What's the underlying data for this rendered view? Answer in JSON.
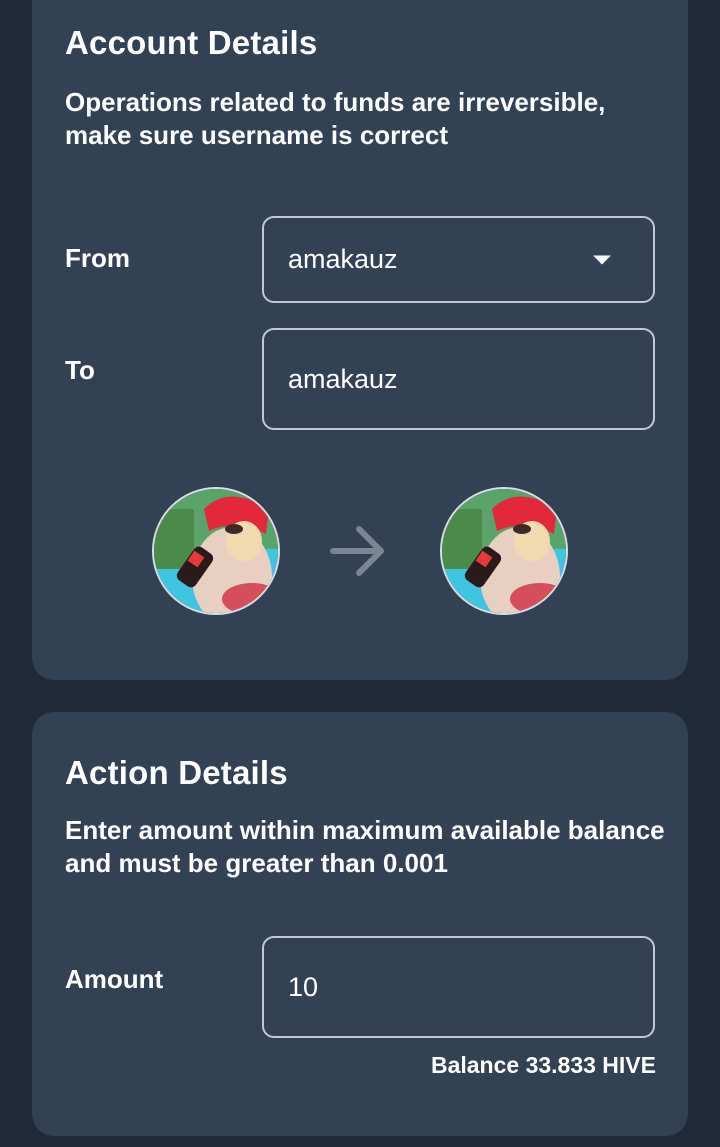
{
  "account": {
    "title": "Account Details",
    "description": "Operations related to funds are irreversible, make sure username is correct",
    "from_label": "From",
    "from_value": "amakauz",
    "to_label": "To",
    "to_value": "amakauz"
  },
  "action": {
    "title": "Action Details",
    "description": "Enter amount within maximum available balance  and must be greater than 0.001",
    "amount_label": "Amount",
    "amount_value": "10",
    "balance": "Balance 33.833 HIVE"
  },
  "icons": {
    "dropdown": "chevron-down-icon",
    "transfer_arrow": "arrow-right-icon"
  },
  "colors": {
    "background": "#1f2937",
    "card": "#334155",
    "field_border": "#c3c9d2",
    "arrow": "#7b8594"
  }
}
